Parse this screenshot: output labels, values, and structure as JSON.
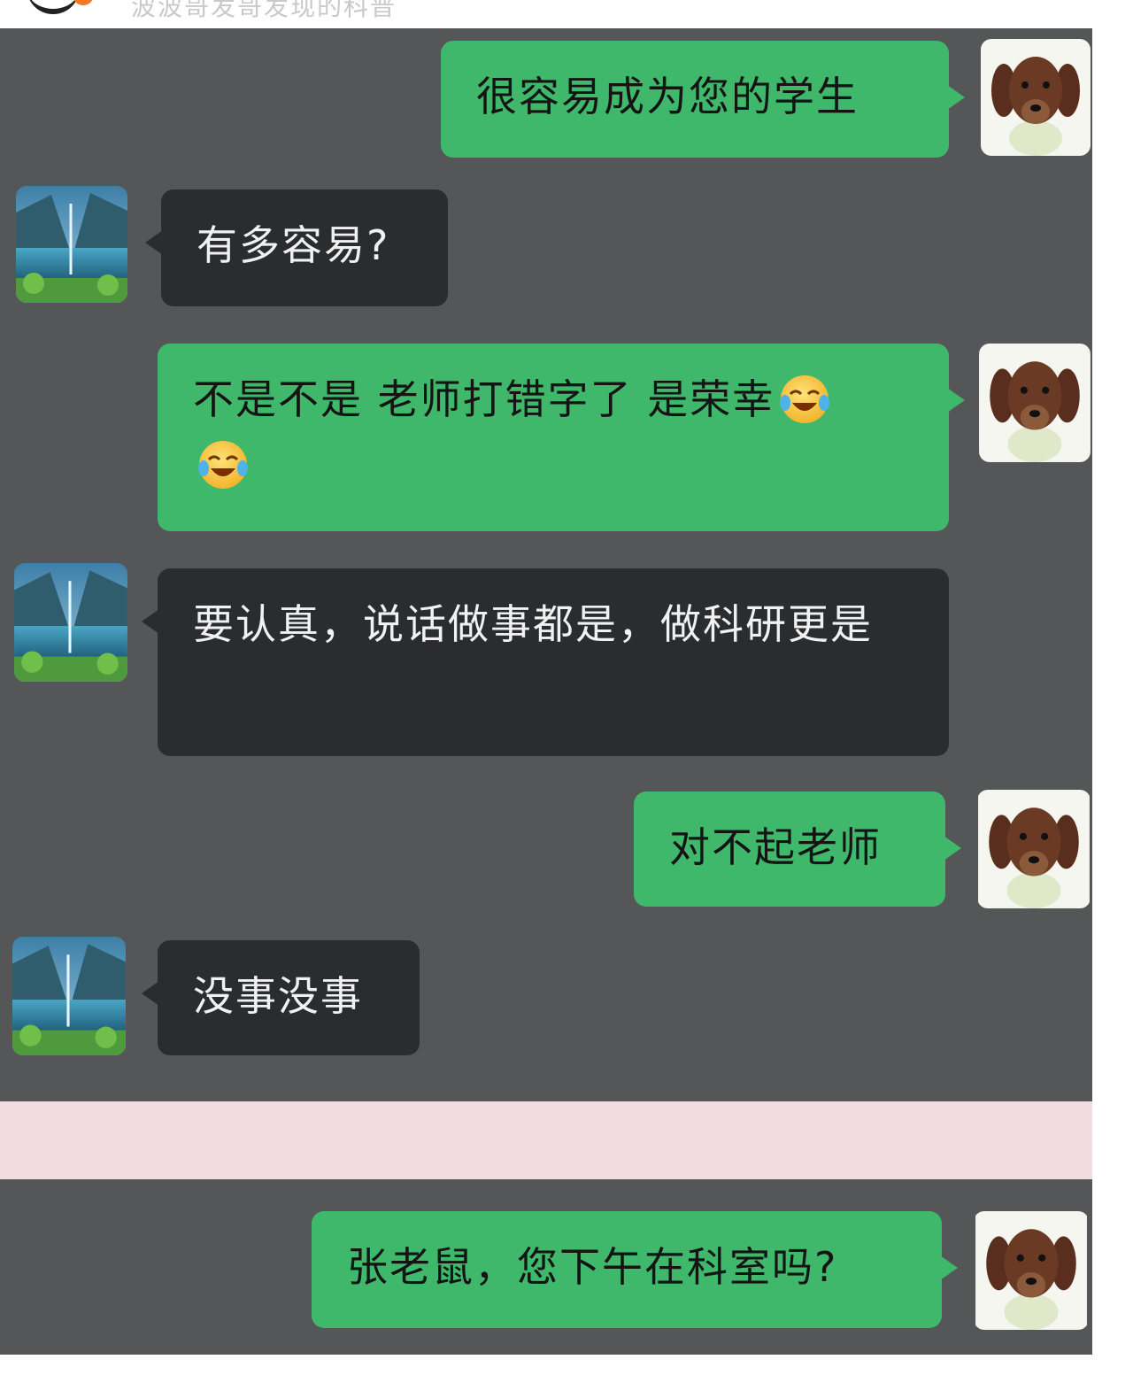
{
  "top_bar": {
    "text": "波波哥发哥发现的科普"
  },
  "messages": [
    {
      "side": "out",
      "text": "很容易成为您的学生",
      "avatar": "dog-avatar"
    },
    {
      "side": "in",
      "text": "有多容易?",
      "avatar": "landscape-avatar"
    },
    {
      "side": "out",
      "text": "不是不是 老师打错字了 是荣幸",
      "emoji": "laughing-crying-emoji",
      "emoji_count": 2,
      "avatar": "dog-avatar"
    },
    {
      "side": "in",
      "text": "要认真，说话做事都是，做科研更是",
      "avatar": "landscape-avatar"
    },
    {
      "side": "out",
      "text": "对不起老师",
      "avatar": "dog-avatar"
    },
    {
      "side": "in",
      "text": "没事没事",
      "avatar": "landscape-avatar"
    },
    {
      "side": "out",
      "text": "张老鼠，您下午在科室吗?",
      "avatar": "dog-avatar"
    }
  ],
  "colors": {
    "chat_background": "#555657",
    "outgoing_bubble": "#3fb86b",
    "incoming_bubble": "#2b2c2e",
    "divider_strip": "#f3dce0"
  }
}
